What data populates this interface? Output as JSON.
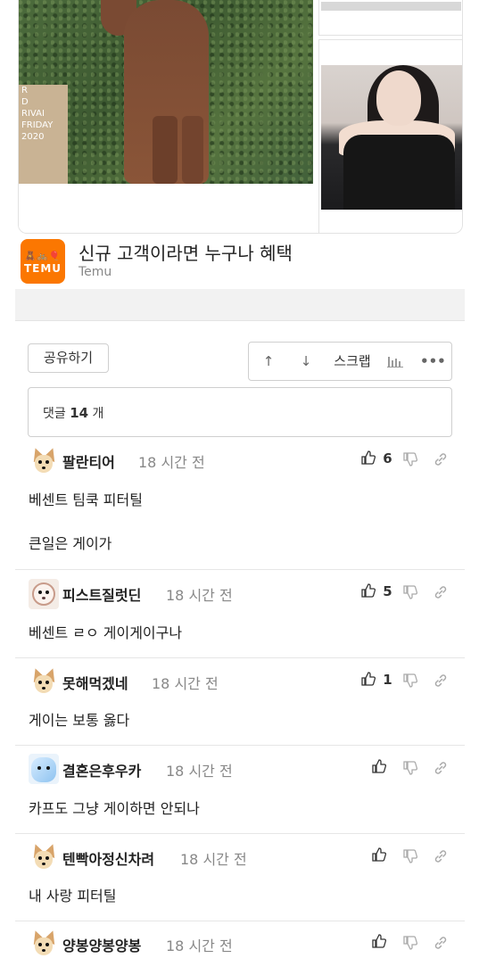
{
  "ad": {
    "sign_lines": [
      "R",
      "D",
      "",
      "RIVAI",
      "FRIDAY",
      "2020"
    ],
    "logo_toys": "🧸🚲🎈",
    "logo_word": "TEMU",
    "title": "신규 고객이라면 누구나 혜택",
    "source": "Temu"
  },
  "actions": {
    "share_label": "공유하기",
    "up_icon": "↑",
    "down_icon": "↓",
    "scrap_label": "스크랩",
    "stats_icon": "bar-chart-icon",
    "more_icon": "•••"
  },
  "comment_count": {
    "prefix": "댓글",
    "count": "14",
    "suffix": "개"
  },
  "comments": [
    {
      "nick": "팔란티어",
      "time": "18 시간 전",
      "likes": "6",
      "lines": [
        "베센트 팀쿡 피터틸",
        "큰일은 게이가"
      ],
      "avatar": "dog"
    },
    {
      "nick": "피스트질럿딘",
      "time": "18 시간 전",
      "likes": "5",
      "lines": [
        "베센트 ㄹㅇ 게이게이구나"
      ],
      "avatar": "puppy"
    },
    {
      "nick": "못해먹겠네",
      "time": "18 시간 전",
      "likes": "1",
      "lines": [
        "게이는 보통 옳다"
      ],
      "avatar": "dog"
    },
    {
      "nick": "결혼은후우카",
      "time": "18 시간 전",
      "likes": "",
      "lines": [
        "카프도 그냥 게이하면 안되나"
      ],
      "avatar": "blue"
    },
    {
      "nick": "텐빡아정신차려",
      "time": "18 시간 전",
      "likes": "",
      "lines": [
        "내 사랑 피터틸"
      ],
      "avatar": "dog"
    },
    {
      "nick": "양봉양봉양봉",
      "time": "18 시간 전",
      "likes": "",
      "lines": [],
      "avatar": "dog"
    }
  ],
  "colors": {
    "temu_orange": "#fb7701",
    "muted_text": "#888888",
    "border": "#cfcfcf"
  }
}
